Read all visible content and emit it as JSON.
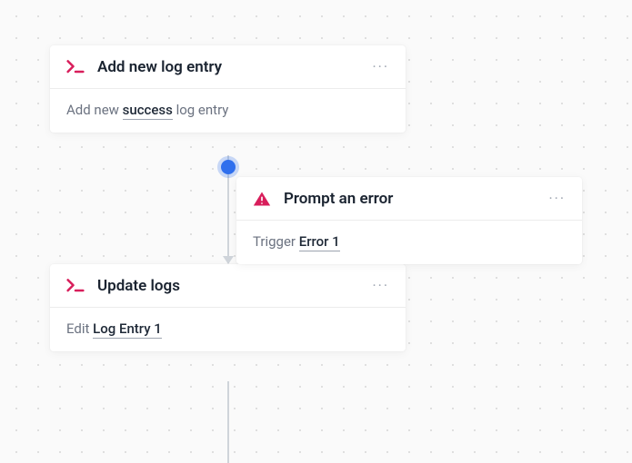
{
  "cards": {
    "add_log": {
      "title": "Add new log entry",
      "body_prefix": "Add new ",
      "body_var": "success",
      "body_suffix": " log entry"
    },
    "prompt_error": {
      "title": "Prompt an error",
      "body_prefix": "Trigger ",
      "body_var": "Error 1",
      "body_suffix": ""
    },
    "update_logs": {
      "title": "Update logs",
      "body_prefix": "Edit ",
      "body_var": "Log Entry 1",
      "body_suffix": ""
    }
  },
  "menu_glyph": "···"
}
